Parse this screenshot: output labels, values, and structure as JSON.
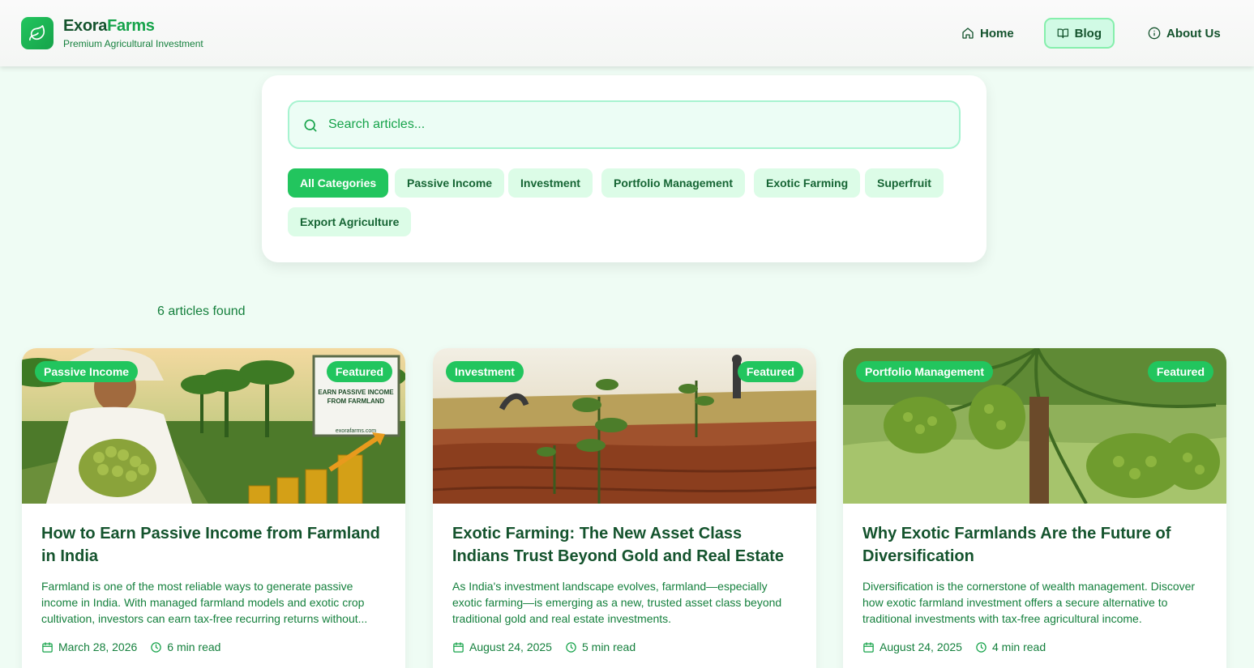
{
  "brand": {
    "name_main": "Exora",
    "name_accent": "Farms",
    "tagline": "Premium Agricultural Investment",
    "logo_icon": "leaf-icon"
  },
  "nav": {
    "home": "Home",
    "blog": "Blog",
    "about": "About Us"
  },
  "search": {
    "placeholder": "Search articles...",
    "value": ""
  },
  "categories": [
    {
      "label": "All Categories",
      "active": true
    },
    {
      "label": "Passive Income",
      "active": false
    },
    {
      "label": "Investment",
      "active": false
    },
    {
      "label": "Portfolio Management",
      "active": false
    },
    {
      "label": "Exotic Farming",
      "active": false
    },
    {
      "label": "Superfruit",
      "active": false
    },
    {
      "label": "Export Agriculture",
      "active": false
    }
  ],
  "results": {
    "count_text": "6 articles found"
  },
  "articles": [
    {
      "category": "Passive Income",
      "featured": "Featured",
      "title": "How to Earn Passive Income from Farmland in India",
      "excerpt": "Farmland is one of the most reliable ways to generate passive income in India. With managed farmland models and exotic crop cultivation, investors can earn tax-free recurring returns without...",
      "date": "March 28, 2026",
      "read_time": "6 min read"
    },
    {
      "category": "Investment",
      "featured": "Featured",
      "title": "Exotic Farming: The New Asset Class Indians Trust Beyond Gold and Real Estate",
      "excerpt": "As India's investment landscape evolves, farmland—especially exotic farming—is emerging as a new, trusted asset class beyond traditional gold and real estate investments.",
      "date": "August 24, 2025",
      "read_time": "5 min read"
    },
    {
      "category": "Portfolio Management",
      "featured": "Featured",
      "title": "Why Exotic Farmlands Are the Future of Diversification",
      "excerpt": "Diversification is the cornerstone of wealth management. Discover how exotic farmland investment offers a secure alternative to traditional investments with tax-free agricultural income.",
      "date": "August 24, 2025",
      "read_time": "4 min read"
    }
  ],
  "image_sign": {
    "line1": "EARN PASSIVE INCOME",
    "line2": "FROM FARMLAND",
    "footer": "exorafarms.com"
  },
  "colors": {
    "accent": "#22c55e",
    "dark_green": "#14532d",
    "chip_bg": "#dcfce7",
    "page_bg": "#effcf4"
  }
}
